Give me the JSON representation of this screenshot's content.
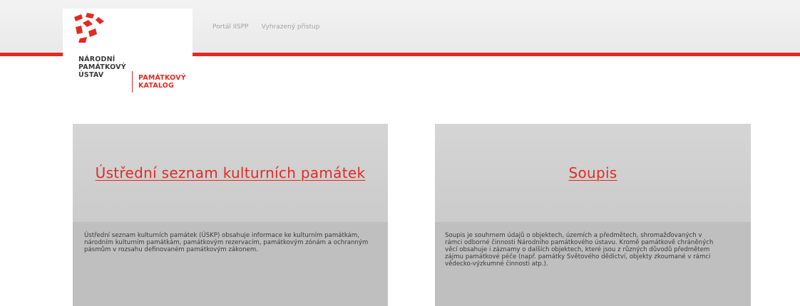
{
  "header": {
    "logo": {
      "institution_lines": "NÁRODNÍ\nPAMÁTKOVÝ\nÚSTAV",
      "catalog_lines": "PAMÁTKOVÝ\nKATALOG"
    },
    "nav": [
      {
        "label": "Portál IISPP"
      },
      {
        "label": "Vyhrazený přístup"
      }
    ]
  },
  "cards": [
    {
      "title": "Ústřední seznam kulturních památek",
      "description": "Ústřední seznam kulturních památek (ÚSKP) obsahuje informace ke kulturním památkám, národním kulturním památkám, památkovým rezervacím, památkovým zónám a ochranným pásmům v rozsahu definovaném památkovým zákonem."
    },
    {
      "title": "Soupis",
      "description": "Soupis je souhrnem údajů o objektech, územích a předmětech, shromažďovaných v rámci odborné činnosti Národního památkového ústavu. Kromě památkově chráněných věcí obsahuje i záznamy o dalších objektech, které jsou z různých důvodů předmětem zájmu památkové péče (např. památky Světového dědictví, objekty zkoumané v rámci vědecko-výzkumné činnosti atp.)."
    }
  ],
  "colors": {
    "accent_red": "#e32a22",
    "card_bg": "#cdcdcd",
    "card_body_bg": "#bfbfbf"
  }
}
